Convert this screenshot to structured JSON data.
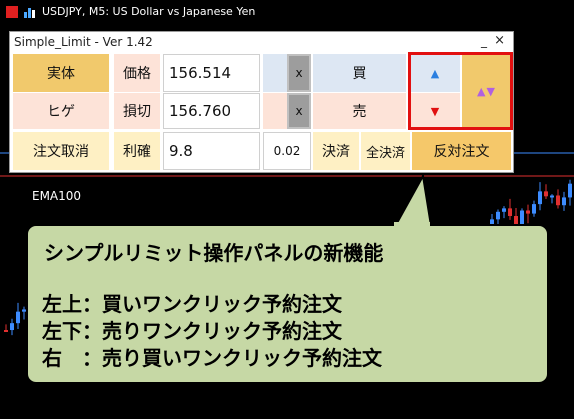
{
  "window": {
    "title": "USDJPY, M5:  US Dollar vs Japanese Yen"
  },
  "panel": {
    "title": "Simple_Limit - Ver 1.42",
    "minimize_glyph": "_",
    "close_glyph": "×",
    "row1": {
      "mode": "実体",
      "label": "価格",
      "value": "156.514",
      "x": "x",
      "action": "買",
      "arrow": "▲"
    },
    "row2": {
      "mode": "ヒゲ",
      "label": "損切",
      "value": "156.760",
      "x": "x",
      "action": "売",
      "arrow": "▼"
    },
    "row3": {
      "cancel": "注文取消",
      "label": "利確",
      "value": "9.8",
      "lot": "0.02",
      "settle": "決済",
      "settle_all": "全決済",
      "reverse": "反対注文"
    },
    "both_arrows": "▲▼"
  },
  "chart": {
    "indicator_label": "EMA100"
  },
  "callout": {
    "headline": "シンプルリミット操作パネルの新機能",
    "line1": "左上：買いワンクリック予約注文",
    "line2": "左下：売りワンクリック予約注文",
    "line3": "右　：売り買いワンクリック予約注文"
  },
  "colors": {
    "buy_arrow": "#2a7fe0",
    "sell_arrow": "#e01010",
    "both_arrows": "#b060e0",
    "highlight": "#e21010",
    "callout_bg": "#c6d8a5",
    "bull_candle": "#3d8cff",
    "bear_candle": "#e03030"
  },
  "icons": [
    "app-logo-icon",
    "chart-bars-icon",
    "minimize-icon",
    "close-icon",
    "up-arrow-icon",
    "down-arrow-icon"
  ]
}
